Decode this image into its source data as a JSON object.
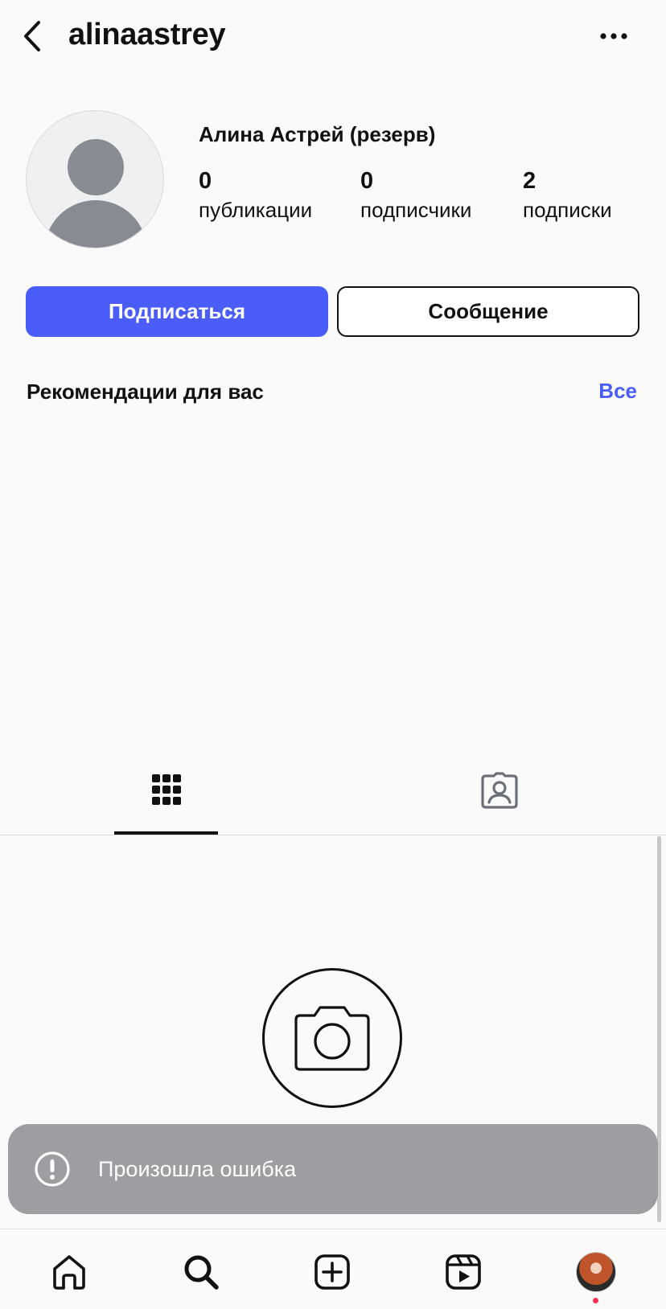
{
  "header": {
    "username": "alinaastrey",
    "back_icon": "chevron-left-icon",
    "more_icon": "more-horizontal-icon"
  },
  "profile": {
    "full_name": "Алина Астрей (резерв)",
    "stats": [
      {
        "value": "0",
        "label": "публикации"
      },
      {
        "value": "0",
        "label": "подписчики"
      },
      {
        "value": "2",
        "label": "подписки"
      }
    ]
  },
  "actions": {
    "follow_label": "Подписаться",
    "message_label": "Сообщение"
  },
  "recommendations": {
    "title": "Рекомендации для вас",
    "see_all": "Все"
  },
  "tabs": {
    "active": "grid",
    "items": [
      "grid-icon",
      "tagged-icon"
    ]
  },
  "toast": {
    "message": "Произошла ошибка",
    "icon": "alert-circle-icon"
  },
  "nav": {
    "items": [
      "home-icon",
      "search-icon",
      "create-icon",
      "reels-icon",
      "profile-avatar"
    ]
  },
  "colors": {
    "accent": "#4a5df9",
    "toast_bg": "#9d9ea2",
    "notification_dot": "#ff2e4e"
  }
}
